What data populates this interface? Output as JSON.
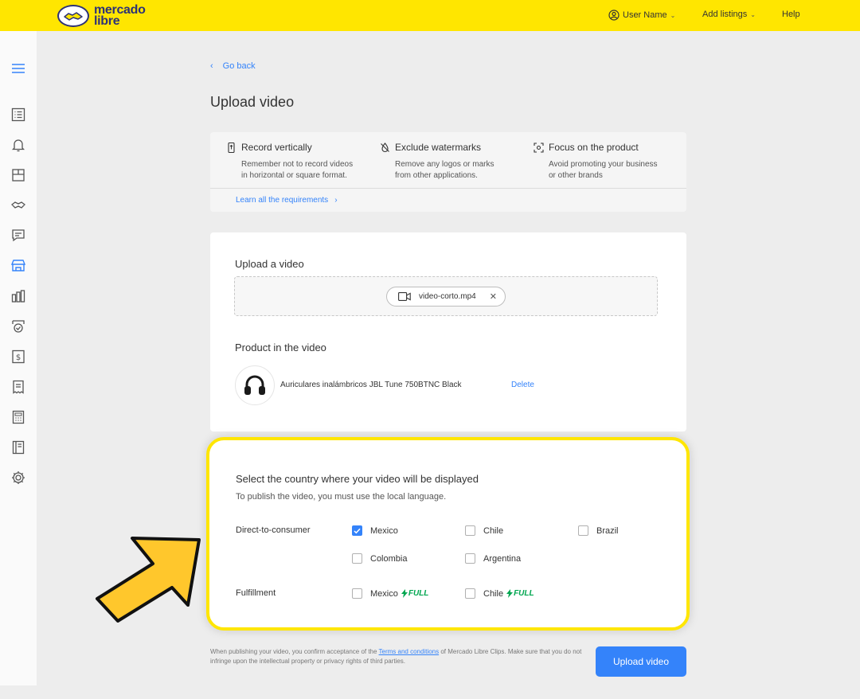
{
  "header": {
    "logo_line1": "mercado",
    "logo_line2": "libre",
    "user_menu": "User Name",
    "add_listings": "Add listings",
    "help": "Help"
  },
  "sidebar": {
    "items": [
      "menu-icon",
      "list-icon",
      "bell-icon",
      "package-icon",
      "handshake-icon",
      "chat-icon",
      "store-icon",
      "bar-chart-icon",
      "badge-icon",
      "money-icon",
      "receipt-icon",
      "calculator-icon",
      "book-icon",
      "gear-icon"
    ],
    "active": "store-icon"
  },
  "nav": {
    "go_back": "Go back"
  },
  "page": {
    "title": "Upload video"
  },
  "requirements": {
    "items": [
      {
        "title": "Record vertically",
        "desc_line1": "Remember not to record videos",
        "desc_line2": "in horizontal or square format.",
        "icon": "phone-icon"
      },
      {
        "title": "Exclude watermarks",
        "desc_line1": "Remove any logos or marks",
        "desc_line2": "from other applications.",
        "icon": "no-watermark-icon"
      },
      {
        "title": "Focus on the product",
        "desc_line1": "Avoid promoting your business",
        "desc_line2": "or other brands",
        "icon": "focus-icon"
      }
    ],
    "learn_link": "Learn all the requirements"
  },
  "upload": {
    "label": "Upload a video",
    "file_name": "video-corto.mp4",
    "product_label": "Product in the video",
    "product_name": "Auriculares inalámbricos JBL Tune 750BTNC Black",
    "delete_label": "Delete"
  },
  "country": {
    "title": "Select the country where your video will be displayed",
    "subtitle": "To publish the video, you must use the local language.",
    "dtc_label": "Direct-to-consumer",
    "fulfillment_label": "Fulfillment",
    "dtc_options": [
      {
        "label": "Mexico",
        "checked": true
      },
      {
        "label": "Chile",
        "checked": false
      },
      {
        "label": "Brazil",
        "checked": false
      },
      {
        "label": "Colombia",
        "checked": false
      },
      {
        "label": "Argentina",
        "checked": false
      }
    ],
    "fulfillment_options": [
      {
        "label": "Mexico",
        "checked": false
      },
      {
        "label": "Chile",
        "checked": false
      }
    ],
    "full_badge": "FULL"
  },
  "footer": {
    "disclaimer_pre": "When publishing your video, you confirm acceptance of the ",
    "terms_link": "Terms and conditions",
    "disclaimer_post": " of Mercado Libre Clips. Make sure that you do not infringe upon the intellectual property or privacy rights of third parties.",
    "upload_button": "Upload video"
  },
  "colors": {
    "brand_yellow": "#ffe600",
    "accent_blue": "#3483fa",
    "full_green": "#00a650"
  }
}
